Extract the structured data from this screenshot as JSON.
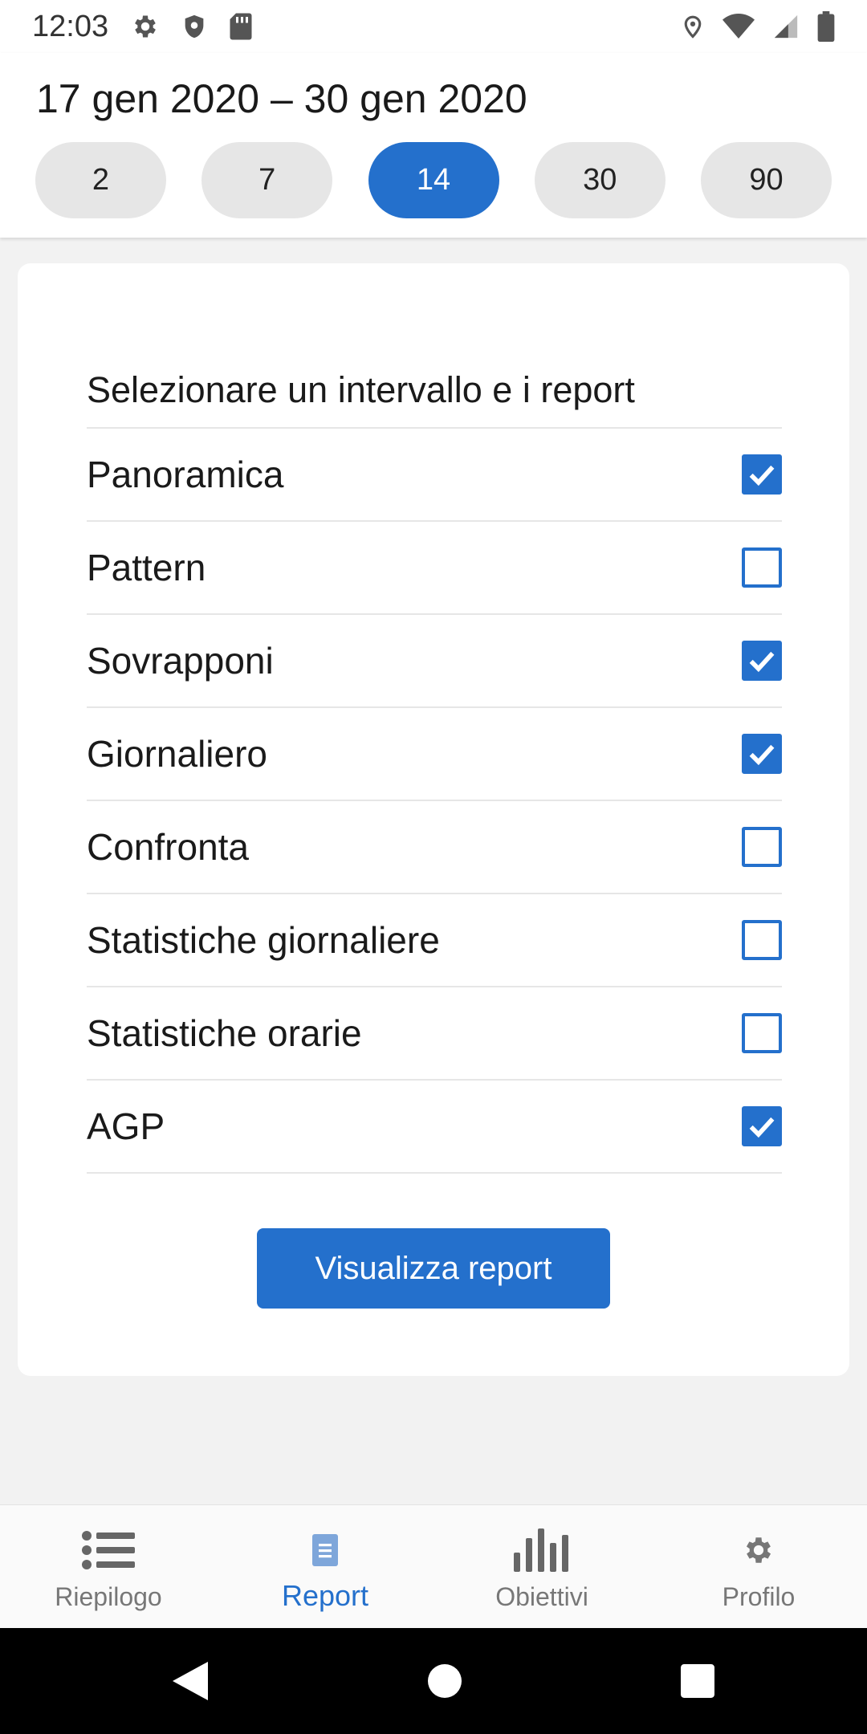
{
  "status_bar": {
    "time": "12:03",
    "left_icons": [
      "gear-icon",
      "shield-icon",
      "sd-card-icon"
    ],
    "right_icons": [
      "location-icon",
      "wifi-icon",
      "signal-icon",
      "battery-icon"
    ]
  },
  "header": {
    "date_range": "17 gen 2020 – 30 gen 2020",
    "chips": [
      {
        "label": "2",
        "selected": false
      },
      {
        "label": "7",
        "selected": false
      },
      {
        "label": "14",
        "selected": true
      },
      {
        "label": "30",
        "selected": false
      },
      {
        "label": "90",
        "selected": false
      }
    ]
  },
  "card": {
    "title": "Selezionare un intervallo e i report",
    "options": [
      {
        "label": "Panoramica",
        "checked": true
      },
      {
        "label": "Pattern",
        "checked": false
      },
      {
        "label": "Sovrapponi",
        "checked": true
      },
      {
        "label": "Giornaliero",
        "checked": true
      },
      {
        "label": "Confronta",
        "checked": false
      },
      {
        "label": "Statistiche giornaliere",
        "checked": false
      },
      {
        "label": "Statistiche orarie",
        "checked": false
      },
      {
        "label": "AGP",
        "checked": true
      }
    ],
    "button_label": "Visualizza report"
  },
  "bottom_nav": {
    "items": [
      {
        "label": "Riepilogo",
        "icon": "list-icon",
        "active": false
      },
      {
        "label": "Report",
        "icon": "document-icon",
        "active": true
      },
      {
        "label": "Obiettivi",
        "icon": "bar-chart-icon",
        "active": false
      },
      {
        "label": "Profilo",
        "icon": "gear-icon",
        "active": false
      }
    ]
  },
  "system_nav": {
    "buttons": [
      "back-icon",
      "home-icon",
      "recents-icon"
    ]
  },
  "colors": {
    "accent": "#2470cc",
    "chip_bg": "#e6e6e6",
    "background": "#f2f2f2"
  }
}
